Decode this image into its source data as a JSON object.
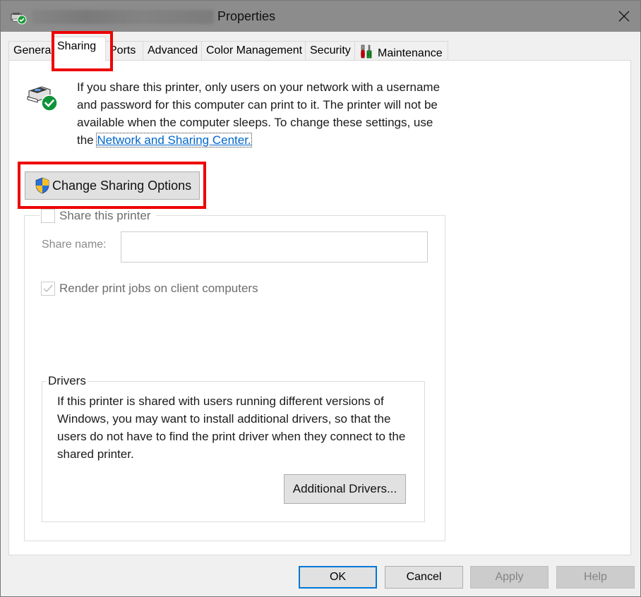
{
  "window": {
    "title_suffix": "Properties",
    "title_prefix_redacted": true
  },
  "tabs": [
    {
      "label": "General",
      "active": false
    },
    {
      "label": "Sharing",
      "active": true
    },
    {
      "label": "Ports",
      "active": false
    },
    {
      "label": "Advanced",
      "active": false
    },
    {
      "label": "Color Management",
      "active": false
    },
    {
      "label": "Security",
      "active": false
    },
    {
      "label": "Maintenance",
      "active": false,
      "icon": "tools-icon"
    }
  ],
  "sharing": {
    "info_text": "If you share this printer, only users on your network with a username and password for this computer can print to it. The printer will not be available when the computer sleeps. To change these settings, use the ",
    "info_link": "Network and Sharing Center.",
    "change_button": "Change Sharing Options",
    "share_checkbox": {
      "label": "Share this printer",
      "checked": false,
      "enabled": false
    },
    "share_name": {
      "label": "Share name:",
      "value": "",
      "enabled": false
    },
    "render_checkbox": {
      "label": "Render print jobs on client computers",
      "checked": true,
      "enabled": false
    },
    "drivers": {
      "legend": "Drivers",
      "text": "If this printer is shared with users running different versions of Windows, you may want to install additional drivers, so that the users do not have to find the print driver when they connect to the shared printer.",
      "button": "Additional Drivers..."
    }
  },
  "footer": {
    "ok": "OK",
    "cancel": "Cancel",
    "apply": "Apply",
    "help": "Help"
  },
  "colors": {
    "highlight": "#ee0000",
    "link": "#0066cc",
    "default_button_border": "#0078d7",
    "titlebar": "#8c8c8c"
  }
}
